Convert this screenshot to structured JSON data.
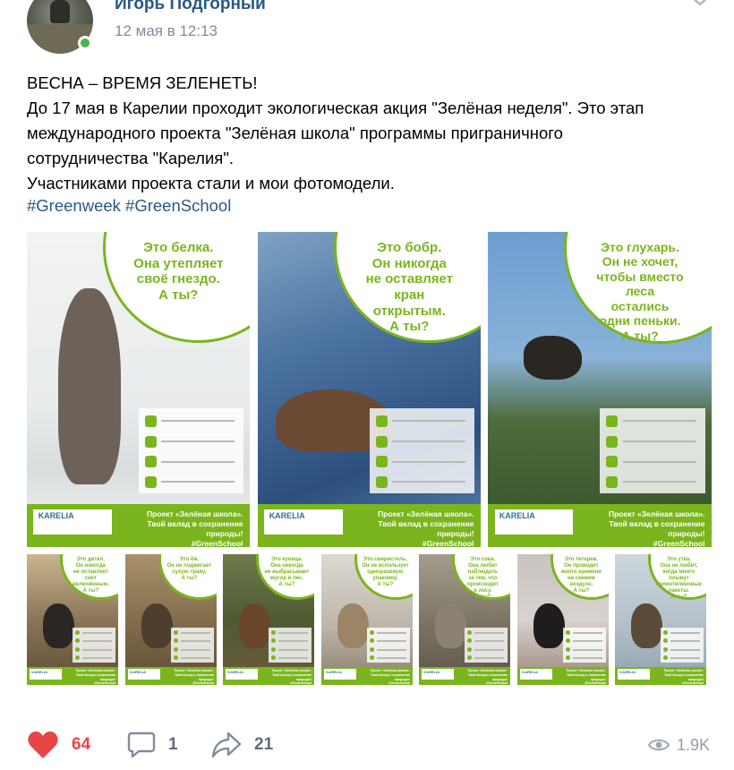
{
  "author": {
    "name": "Игорь Подгорный",
    "date": "12 мая в 12:13",
    "online": true
  },
  "post": {
    "lines": [
      "ВЕСНА – ВРЕМЯ ЗЕЛЕНЕТЬ!",
      "До 17 мая в Карелии проходит экологическая акция \"Зелёная неделя\". Это этап",
      "международного проекта \"Зелёная школа\" программы приграничного",
      "сотрудничества \"Карелия\".",
      "Участниками проекта стали и мои фотомодели."
    ],
    "hashtags": [
      "#Greenweek",
      "#GreenSchool"
    ]
  },
  "posters_large": [
    {
      "animal": "squirrel",
      "bubble": "Это белка.\nОна утепляет\nсвоё гнездо.\nА ты?"
    },
    {
      "animal": "beaver",
      "bubble": "Это бобр.\nОн никогда\nне оставляет\nкран\nоткрытым.\nА ты?"
    },
    {
      "animal": "capercaillie",
      "bubble": "Это глухарь.\nОн не хочет,\nчтобы вместо\nлеса\nостались\nодни пеньки.\nА ты?"
    }
  ],
  "posters_small": [
    {
      "animal": "woodpecker",
      "bubble": "Это дятел.\nОн никогда\nне оставляет\nсвет\nвключённым.\nА ты?"
    },
    {
      "animal": "hedgehog",
      "bubble": "Это ёж.\nОн не поджигает\nсухую траву.\nА ты?"
    },
    {
      "animal": "marten",
      "bubble": "Это куница.\nОна никогда\nне выбрасывает\nмусор в лес.\nА ты?"
    },
    {
      "animal": "waxwing",
      "bubble": "Это свиристель.\nОн не использует\nодноразовую\nупаковку.\nА ты?"
    },
    {
      "animal": "owl",
      "bubble": "Это сова.\nОна любит\nнаблюдать\nза тем, что\nпроисходит\nв лесу.\nА ты?"
    },
    {
      "animal": "black-grouse",
      "bubble": "Это тетерев.\nОн проводит\nмного времени\nна свежем\nвоздухе.\nА ты?"
    },
    {
      "animal": "duck",
      "bubble": "Это утка.\nОна не любит,\nкогда много\nплывут\nполиэтиленовые\nпакеты.\nА ты?"
    }
  ],
  "poster_footer": {
    "logo": "KARELIA",
    "text": "Проект «Зелёная школа».\nТвой вклад в сохранение природы!\n#GreenSchool"
  },
  "stats": {
    "likes": "64",
    "comments": "1",
    "shares": "21",
    "views": "1.9K"
  },
  "colors": {
    "brand_green": "#7ab51d",
    "link": "#2a5885",
    "like_red": "#e64646",
    "online": "#4bb34b"
  }
}
